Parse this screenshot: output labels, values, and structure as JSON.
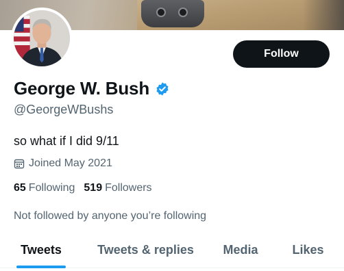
{
  "profile": {
    "display_name": "George W. Bush",
    "handle": "@GeorgeWBushs",
    "bio": "so what if I did 9/11",
    "joined": "Joined May 2021",
    "verified": true
  },
  "actions": {
    "follow_label": "Follow"
  },
  "stats": {
    "following_count": "65",
    "following_label": "Following",
    "followers_count": "519",
    "followers_label": "Followers"
  },
  "followed_note": "Not followed by anyone you’re following",
  "tabs": [
    {
      "label": "Tweets",
      "active": true
    },
    {
      "label": "Tweets & replies",
      "active": false
    },
    {
      "label": "Media",
      "active": false
    },
    {
      "label": "Likes",
      "active": false
    }
  ],
  "icons": {
    "verified": "verified-badge-icon",
    "calendar": "calendar-icon"
  },
  "colors": {
    "accent": "#1d9bf0",
    "text_primary": "#0f1419",
    "text_secondary": "#536471",
    "button_bg": "#0f1419"
  }
}
